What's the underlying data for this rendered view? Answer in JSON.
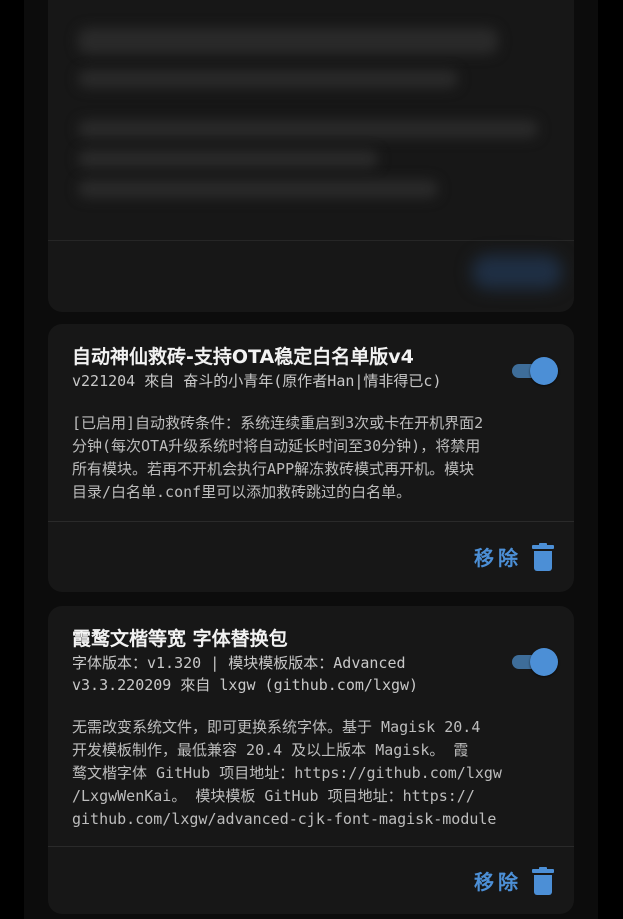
{
  "modules": [
    {
      "title": "自动神仙救砖-支持OTA稳定白名单版v4",
      "meta_lines": [
        "v221204 來自 奋斗的小青年(原作者Han|情非得已c)"
      ],
      "description_lines": [
        "[已启用]自动救砖条件：系统连续重启到3次或卡在开机界面2",
        "分钟(每次OTA升级系统时将自动延长时间至30分钟)，将禁用",
        "所有模块。若再不开机会执行APP解冻救砖模式再开机。模块",
        "目录/白名单.conf里可以添加救砖跳过的白名单。"
      ],
      "enabled": true,
      "remove_label": "移除"
    },
    {
      "title": "霞鹜文楷等宽 字体替换包",
      "meta_lines": [
        "字体版本：v1.320 | 模块模板版本：Advanced",
        "v3.3.220209 來自 lxgw (github.com/lxgw)"
      ],
      "description_lines": [
        "无需改变系统文件，即可更换系统字体。基于 Magisk 20.4",
        "开发模板制作，最低兼容 20.4 及以上版本 Magisk。 霞",
        "鹜文楷字体 GitHub 项目地址：https://github.com/lxgw",
        "/LxgwWenKai。 模块模板 GitHub 项目地址：https://",
        "github.com/lxgw/advanced-cjk-font-magisk-module"
      ],
      "enabled": true,
      "remove_label": "移除"
    }
  ],
  "colors": {
    "accent": "#4c8fd6",
    "card_bg": "#171717",
    "page_bg": "#0c0c0c"
  },
  "icons": {
    "toggle": "switch-on-icon",
    "remove": "trash-icon"
  }
}
